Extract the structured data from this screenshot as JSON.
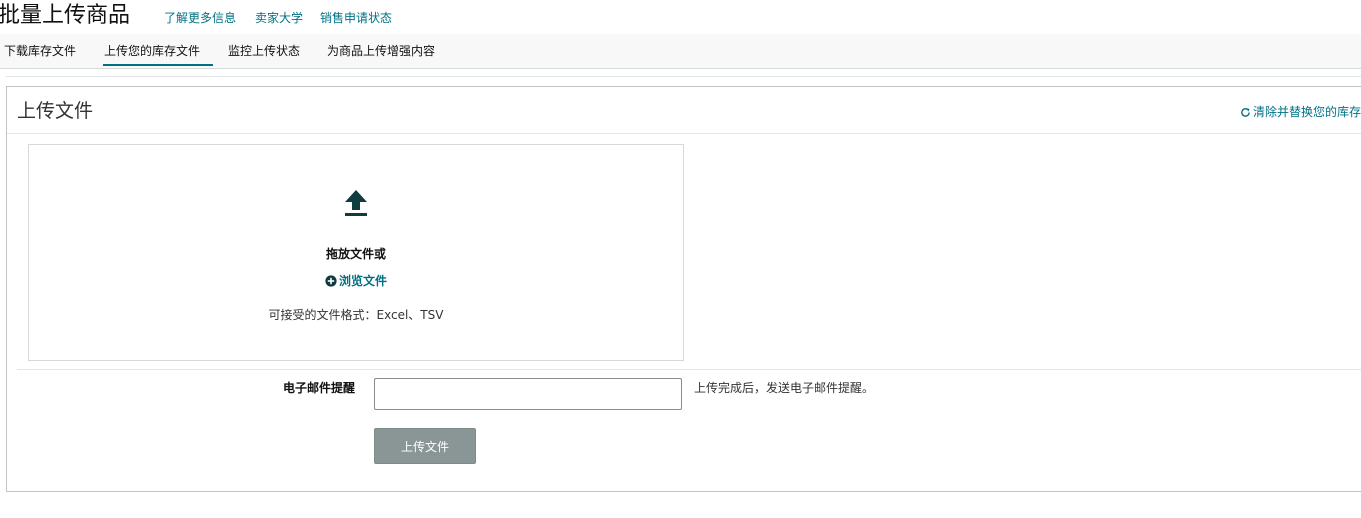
{
  "header": {
    "title": "批量上传商品",
    "links": [
      "了解更多信息",
      "卖家大学",
      "销售申请状态"
    ]
  },
  "tabs": [
    {
      "label": "下载库存文件",
      "active": false
    },
    {
      "label": "上传您的库存文件",
      "active": true
    },
    {
      "label": "监控上传状态",
      "active": false
    },
    {
      "label": "为商品上传增强内容",
      "active": false
    }
  ],
  "card": {
    "title": "上传文件",
    "replace_link": "清除并替换您的库存"
  },
  "dropzone": {
    "icon": "upload-icon",
    "drop_text": "拖放文件或",
    "browse_label": "浏览文件",
    "formats": "可接受的文件格式：Excel、TSV"
  },
  "email": {
    "label": "电子邮件提醒",
    "value": "",
    "placeholder": "",
    "hint": "上传完成后，发送电子邮件提醒。"
  },
  "upload_button": "上传文件",
  "colors": {
    "link": "#007185",
    "tab_underline": "#007185",
    "button_disabled": "#8a9696",
    "icon_dark": "#0f3d3e"
  }
}
